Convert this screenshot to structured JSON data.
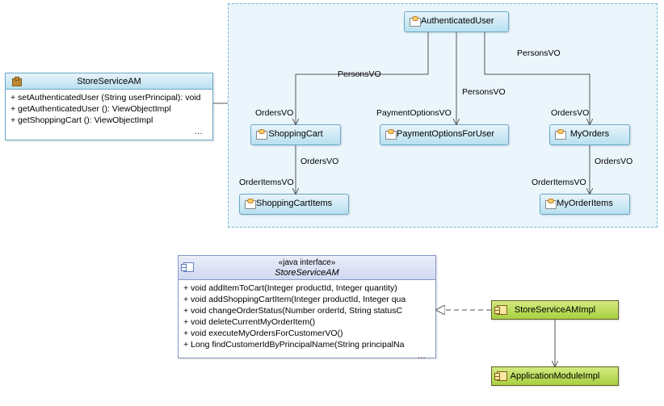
{
  "am": {
    "title": "StoreServiceAM",
    "methods": [
      "+ setAuthenticatedUser (String userPrincipal): void",
      "+ getAuthenticatedUser (): ViewObjectImpl",
      "+ getShoppingCart (): ViewObjectImpl"
    ],
    "more": "…"
  },
  "nodes": {
    "authUser": "AuthenticatedUser",
    "shoppingCart": "ShoppingCart",
    "paymentOptions": "PaymentOptionsForUser",
    "myOrders": "MyOrders",
    "shoppingCartItems": "ShoppingCartItems",
    "myOrderItems": "MyOrderItems"
  },
  "edges": {
    "personsVO_left": "PersonsVO",
    "personsVO_mid": "PersonsVO",
    "personsVO_right": "PersonsVO",
    "ordersVO_left": "OrdersVO",
    "paymentOptionsVO": "PaymentOptionsVO",
    "ordersVO_right": "OrdersVO",
    "ordersVO_cart": "OrdersVO",
    "orderItemsVO_cart": "OrderItemsVO",
    "ordersVO_myOrders": "OrdersVO",
    "orderItemsVO_myOrders": "OrderItemsVO"
  },
  "iface": {
    "stereotype": "«java interface»",
    "name": "StoreServiceAM",
    "methods": [
      "+ void addItemToCart(Integer productId, Integer quantity)",
      "+ void addShoppingCartItem(Integer productId, Integer qua",
      "+ void changeOrderStatus(Number orderId, String statusC",
      "+ void deleteCurrentMyOrderItem()",
      "+ void executeMyOrdersForCustomerVO()",
      "+ Long findCustomerIdByPrincipalName(String principalNa"
    ],
    "more": "…"
  },
  "impl": {
    "storeServiceAMImpl": "StoreServiceAMImpl",
    "applicationModuleImpl": "ApplicationModuleImpl"
  }
}
